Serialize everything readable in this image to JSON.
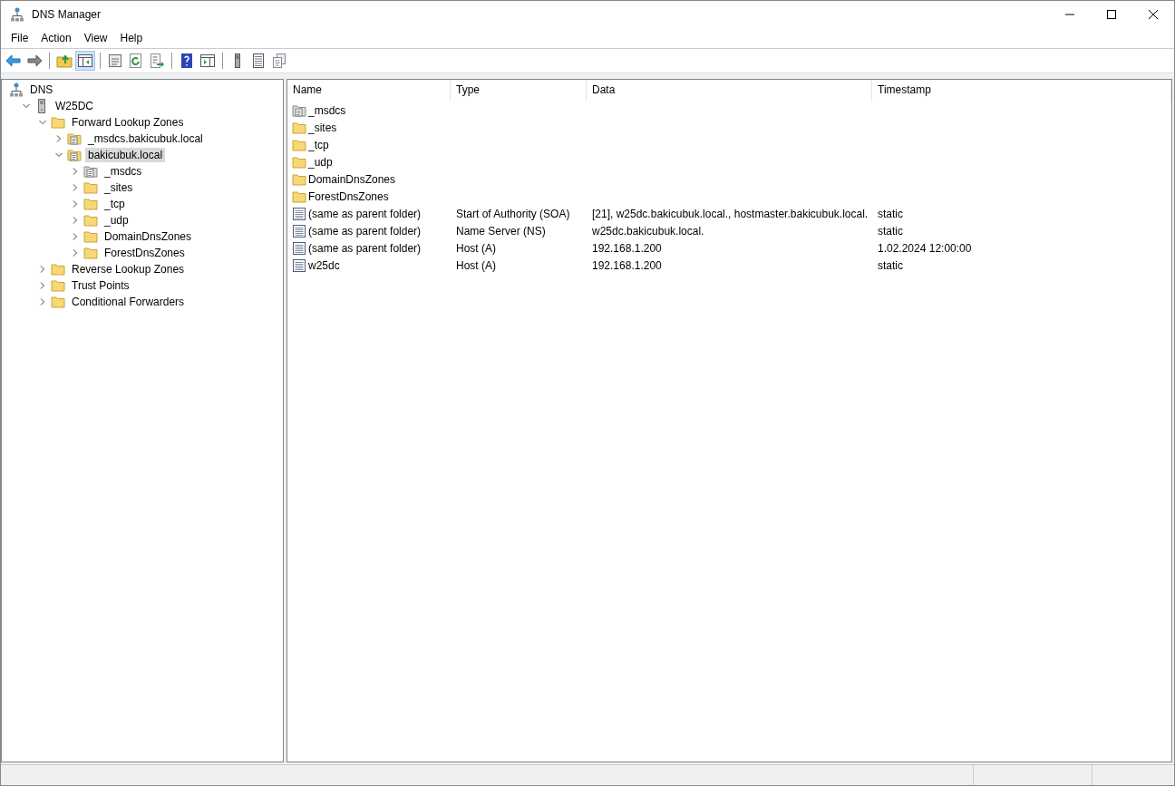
{
  "window": {
    "title": "DNS Manager"
  },
  "menu": [
    "File",
    "Action",
    "View",
    "Help"
  ],
  "toolbar": [
    {
      "kind": "back",
      "pressed": false
    },
    {
      "kind": "forward",
      "pressed": false
    },
    {
      "kind": "sep"
    },
    {
      "kind": "up",
      "pressed": false
    },
    {
      "kind": "tree",
      "pressed": true
    },
    {
      "kind": "sep"
    },
    {
      "kind": "properties",
      "pressed": false
    },
    {
      "kind": "refresh",
      "pressed": false
    },
    {
      "kind": "export",
      "pressed": false
    },
    {
      "kind": "sep"
    },
    {
      "kind": "help",
      "pressed": false
    },
    {
      "kind": "pane",
      "pressed": false
    },
    {
      "kind": "sep"
    },
    {
      "kind": "server",
      "pressed": false
    },
    {
      "kind": "list",
      "pressed": false
    },
    {
      "kind": "copy",
      "pressed": false
    }
  ],
  "tree": [
    {
      "label": "DNS",
      "kind": "dns",
      "selected": false,
      "children": [
        {
          "label": "W25DC",
          "kind": "server",
          "expanded": true,
          "selected": false,
          "children": [
            {
              "label": "Forward Lookup Zones",
              "kind": "folder",
              "expanded": true,
              "selected": false,
              "children": [
                {
                  "label": "_msdcs.bakicubuk.local",
                  "kind": "zone",
                  "expanded": false,
                  "selected": false
                },
                {
                  "label": "bakicubuk.local",
                  "kind": "zone",
                  "expanded": true,
                  "selected": true,
                  "children": [
                    {
                      "label": "_msdcs",
                      "kind": "delegation",
                      "expanded": false,
                      "selected": false
                    },
                    {
                      "label": "_sites",
                      "kind": "folder",
                      "expanded": false,
                      "selected": false
                    },
                    {
                      "label": "_tcp",
                      "kind": "folder",
                      "expanded": false,
                      "selected": false
                    },
                    {
                      "label": "_udp",
                      "kind": "folder",
                      "expanded": false,
                      "selected": false
                    },
                    {
                      "label": "DomainDnsZones",
                      "kind": "folder",
                      "expanded": false,
                      "selected": false
                    },
                    {
                      "label": "ForestDnsZones",
                      "kind": "folder",
                      "expanded": false,
                      "selected": false
                    }
                  ]
                }
              ]
            },
            {
              "label": "Reverse Lookup Zones",
              "kind": "folder",
              "expanded": false,
              "selected": false
            },
            {
              "label": "Trust Points",
              "kind": "folder",
              "expanded": false,
              "selected": false
            },
            {
              "label": "Conditional Forwarders",
              "kind": "folder",
              "expanded": false,
              "selected": false
            }
          ]
        }
      ]
    }
  ],
  "table": {
    "columns": [
      "Name",
      "Type",
      "Data",
      "Timestamp"
    ],
    "rows": [
      {
        "kind": "delegation",
        "cells": [
          "_msdcs"
        ]
      },
      {
        "kind": "folder",
        "cells": [
          "_sites"
        ]
      },
      {
        "kind": "folder",
        "cells": [
          "_tcp"
        ]
      },
      {
        "kind": "folder",
        "cells": [
          "_udp"
        ]
      },
      {
        "kind": "folder",
        "cells": [
          "DomainDnsZones"
        ]
      },
      {
        "kind": "folder",
        "cells": [
          "ForestDnsZones"
        ]
      },
      {
        "kind": "record",
        "cells": [
          "(same as parent folder)",
          "Start of Authority (SOA)",
          "[21], w25dc.bakicubuk.local., hostmaster.bakicubuk.local.",
          "static"
        ]
      },
      {
        "kind": "record",
        "cells": [
          "(same as parent folder)",
          "Name Server (NS)",
          "w25dc.bakicubuk.local.",
          "static"
        ]
      },
      {
        "kind": "record",
        "cells": [
          "(same as parent folder)",
          "Host (A)",
          "192.168.1.200",
          "1.02.2024 12:00:00"
        ]
      },
      {
        "kind": "record",
        "cells": [
          "w25dc",
          "Host (A)",
          "192.168.1.200",
          "static"
        ]
      }
    ]
  }
}
